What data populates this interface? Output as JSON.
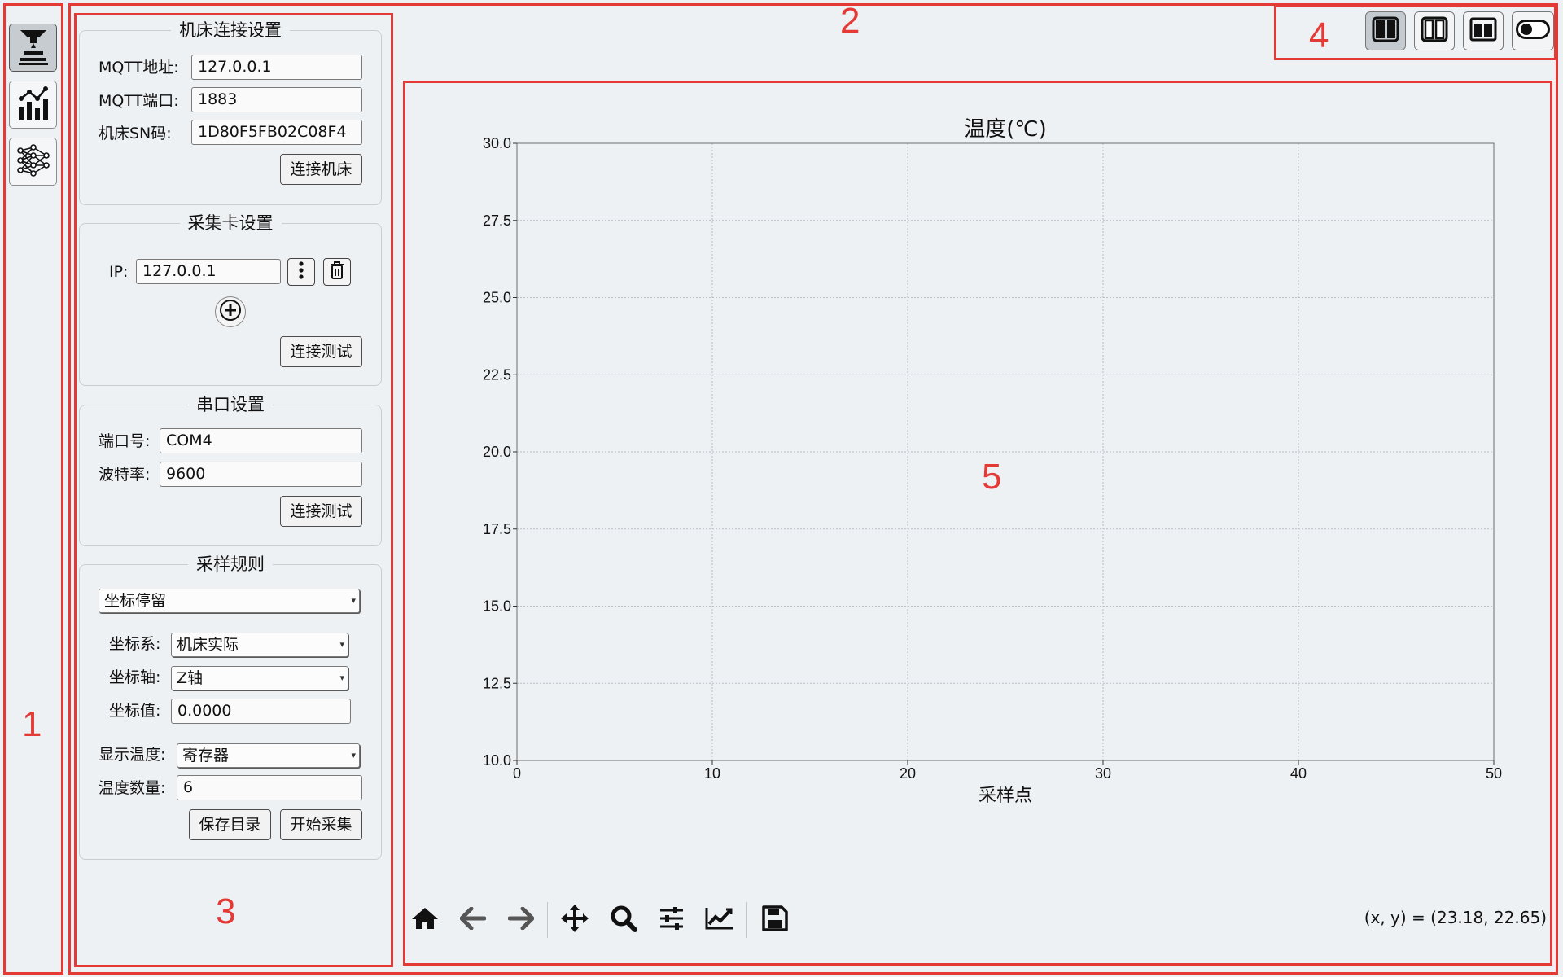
{
  "annotations": {
    "n1": "1",
    "n2": "2",
    "n3": "3",
    "n4": "4",
    "n5": "5"
  },
  "sidebar": {
    "icons": [
      {
        "name": "machine-tool-icon",
        "active": true
      },
      {
        "name": "bar-chart-icon",
        "active": false
      },
      {
        "name": "neural-network-icon",
        "active": false
      }
    ]
  },
  "machine": {
    "title": "机床连接设置",
    "mqtt_addr_label": "MQTT地址:",
    "mqtt_addr_value": "127.0.0.1",
    "mqtt_port_label": "MQTT端口:",
    "mqtt_port_value": "1883",
    "sn_label": "机床SN码:",
    "sn_value": "1D80F5FB02C08F4",
    "connect_label": "连接机床"
  },
  "card": {
    "title": "采集卡设置",
    "ip_label": "IP:",
    "ip_value": "127.0.0.1",
    "test_label": "连接测试"
  },
  "serial": {
    "title": "串口设置",
    "port_label": "端口号:",
    "port_value": "COM4",
    "baud_label": "波特率:",
    "baud_value": "9600",
    "test_label": "连接测试"
  },
  "sampling": {
    "title": "采样规则",
    "rule_value": "坐标停留",
    "coord_sys_label": "坐标系:",
    "coord_sys_value": "机床实际",
    "axis_label": "坐标轴:",
    "axis_value": "Z轴",
    "coord_val_label": "坐标值:",
    "coord_val_value": "0.0000",
    "display_temp_label": "显示温度:",
    "display_temp_value": "寄存器",
    "temp_count_label": "温度数量:",
    "temp_count_value": "6",
    "save_dir_label": "保存目录",
    "start_label": "开始采集"
  },
  "chart_data": {
    "type": "line",
    "title": "温度(℃)",
    "xlabel": "采样点",
    "ylabel": "",
    "xlim": [
      0,
      50
    ],
    "ylim": [
      10.0,
      30.0
    ],
    "x_ticks": [
      "0",
      "10",
      "20",
      "30",
      "40",
      "50"
    ],
    "y_ticks": [
      "10.0",
      "12.5",
      "15.0",
      "17.5",
      "20.0",
      "22.5",
      "25.0",
      "27.5",
      "30.0"
    ],
    "grid": true,
    "series": []
  },
  "toolbar": {
    "items": [
      "home-icon",
      "back-icon",
      "forward-icon",
      "pan-icon",
      "zoom-icon",
      "configure-subplots-icon",
      "edit-axis-icon",
      "save-figure-icon"
    ],
    "coords_text": "(x, y) = (23.18, 22.65)"
  },
  "colors": {
    "annotation": "#e53935",
    "background": "#eef1f4"
  }
}
